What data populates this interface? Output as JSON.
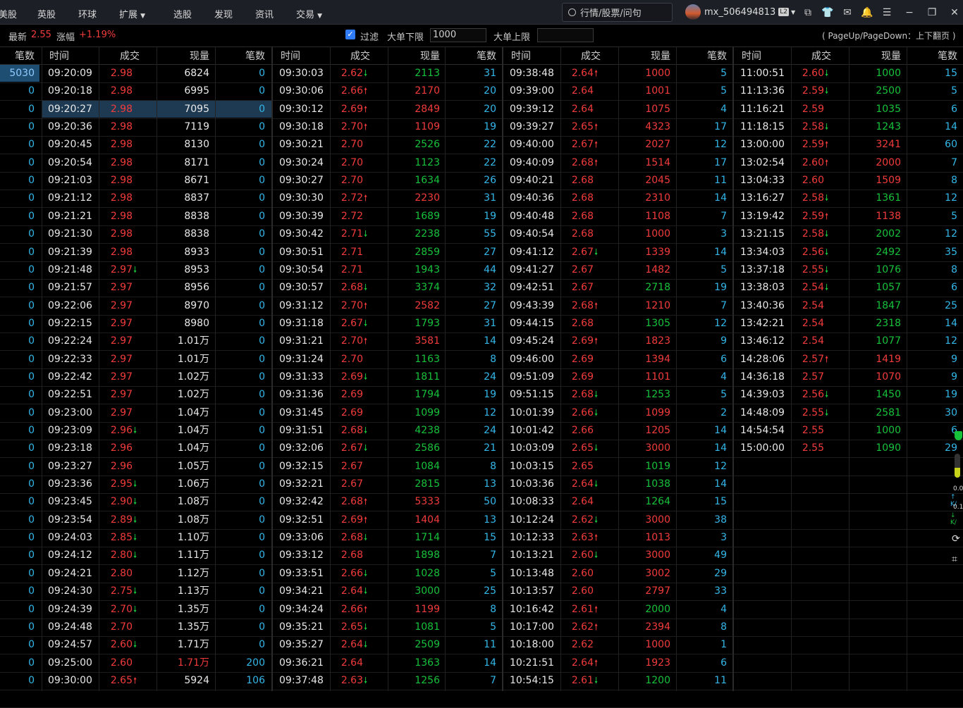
{
  "nav": [
    "美股",
    "英股",
    "环球",
    "扩展",
    "选股",
    "发现",
    "资讯",
    "交易"
  ],
  "search": {
    "placeholder": "行情/股票/问句"
  },
  "user": {
    "name": "mx_506494813",
    "level": "L2"
  },
  "info": {
    "latest_label": "最新",
    "latest_value": "2.55",
    "change_label": "涨幅",
    "change_value": "+1.19%",
    "filter_label": "过滤",
    "lower_label": "大单下限",
    "lower_value": "1000",
    "upper_label": "大单上限",
    "upper_value": "",
    "hint": "( PageUp/PageDown：上下翻页 )"
  },
  "headers": {
    "count": "笔数",
    "time": "时间",
    "price": "成交",
    "vol": "现量"
  },
  "first_count": {
    "value": "5030",
    "selected_row": 2
  },
  "col1": [
    [
      "0",
      "09:20:09",
      "2.98",
      "",
      "6824",
      "0"
    ],
    [
      "0",
      "09:20:18",
      "2.98",
      "",
      "6995",
      "0"
    ],
    [
      "0",
      "09:20:27",
      "2.98",
      "",
      "7095",
      "0"
    ],
    [
      "0",
      "09:20:36",
      "2.98",
      "",
      "7119",
      "0"
    ],
    [
      "0",
      "09:20:45",
      "2.98",
      "",
      "8130",
      "0"
    ],
    [
      "0",
      "09:20:54",
      "2.98",
      "",
      "8171",
      "0"
    ],
    [
      "0",
      "09:21:03",
      "2.98",
      "",
      "8671",
      "0"
    ],
    [
      "0",
      "09:21:12",
      "2.98",
      "",
      "8837",
      "0"
    ],
    [
      "0",
      "09:21:21",
      "2.98",
      "",
      "8838",
      "0"
    ],
    [
      "0",
      "09:21:30",
      "2.98",
      "",
      "8838",
      "0"
    ],
    [
      "0",
      "09:21:39",
      "2.98",
      "",
      "8933",
      "0"
    ],
    [
      "0",
      "09:21:48",
      "2.97",
      "down",
      "8953",
      "0"
    ],
    [
      "0",
      "09:21:57",
      "2.97",
      "",
      "8956",
      "0"
    ],
    [
      "0",
      "09:22:06",
      "2.97",
      "",
      "8970",
      "0"
    ],
    [
      "0",
      "09:22:15",
      "2.97",
      "",
      "8980",
      "0"
    ],
    [
      "0",
      "09:22:24",
      "2.97",
      "",
      "1.01万",
      "0"
    ],
    [
      "0",
      "09:22:33",
      "2.97",
      "",
      "1.01万",
      "0"
    ],
    [
      "0",
      "09:22:42",
      "2.97",
      "",
      "1.02万",
      "0"
    ],
    [
      "0",
      "09:22:51",
      "2.97",
      "",
      "1.02万",
      "0"
    ],
    [
      "0",
      "09:23:00",
      "2.97",
      "",
      "1.04万",
      "0"
    ],
    [
      "0",
      "09:23:09",
      "2.96",
      "down",
      "1.04万",
      "0"
    ],
    [
      "0",
      "09:23:18",
      "2.96",
      "",
      "1.04万",
      "0"
    ],
    [
      "0",
      "09:23:27",
      "2.96",
      "",
      "1.05万",
      "0"
    ],
    [
      "0",
      "09:23:36",
      "2.95",
      "down",
      "1.06万",
      "0"
    ],
    [
      "0",
      "09:23:45",
      "2.90",
      "down",
      "1.08万",
      "0"
    ],
    [
      "0",
      "09:23:54",
      "2.89",
      "down",
      "1.08万",
      "0"
    ],
    [
      "0",
      "09:24:03",
      "2.85",
      "down",
      "1.10万",
      "0"
    ],
    [
      "0",
      "09:24:12",
      "2.80",
      "down",
      "1.11万",
      "0"
    ],
    [
      "0",
      "09:24:21",
      "2.80",
      "",
      "1.12万",
      "0"
    ],
    [
      "0",
      "09:24:30",
      "2.75",
      "down",
      "1.13万",
      "0"
    ],
    [
      "0",
      "09:24:39",
      "2.70",
      "down",
      "1.35万",
      "0"
    ],
    [
      "0",
      "09:24:48",
      "2.70",
      "",
      "1.35万",
      "0"
    ],
    [
      "0",
      "09:24:57",
      "2.60",
      "down",
      "1.71万",
      "0"
    ],
    [
      "0",
      "09:25:00",
      "2.60",
      "",
      "1.71万",
      "200"
    ],
    [
      "0",
      "09:30:00",
      "2.65",
      "up",
      "5924",
      "106"
    ]
  ],
  "col2": [
    [
      "09:30:03",
      "2.62",
      "down",
      "2113",
      "31"
    ],
    [
      "09:30:06",
      "2.66",
      "up",
      "2170",
      "20"
    ],
    [
      "09:30:12",
      "2.69",
      "up",
      "2849",
      "20"
    ],
    [
      "09:30:18",
      "2.70",
      "up",
      "1109",
      "19"
    ],
    [
      "09:30:21",
      "2.70",
      "",
      "2526",
      "22"
    ],
    [
      "09:30:24",
      "2.70",
      "",
      "1123",
      "22"
    ],
    [
      "09:30:27",
      "2.70",
      "",
      "1634",
      "26"
    ],
    [
      "09:30:30",
      "2.72",
      "up",
      "2230",
      "31"
    ],
    [
      "09:30:39",
      "2.72",
      "",
      "1689",
      "19"
    ],
    [
      "09:30:42",
      "2.71",
      "down",
      "2238",
      "55"
    ],
    [
      "09:30:51",
      "2.71",
      "",
      "2859",
      "27"
    ],
    [
      "09:30:54",
      "2.71",
      "",
      "1943",
      "44"
    ],
    [
      "09:30:57",
      "2.68",
      "down",
      "3374",
      "32"
    ],
    [
      "09:31:12",
      "2.70",
      "up",
      "2582",
      "27"
    ],
    [
      "09:31:18",
      "2.67",
      "down",
      "1793",
      "31"
    ],
    [
      "09:31:21",
      "2.70",
      "up",
      "3581",
      "14"
    ],
    [
      "09:31:24",
      "2.70",
      "",
      "1163",
      "8"
    ],
    [
      "09:31:33",
      "2.69",
      "down",
      "1811",
      "24"
    ],
    [
      "09:31:36",
      "2.69",
      "",
      "1794",
      "19"
    ],
    [
      "09:31:45",
      "2.69",
      "",
      "1099",
      "12"
    ],
    [
      "09:31:51",
      "2.68",
      "down",
      "4238",
      "24"
    ],
    [
      "09:32:06",
      "2.67",
      "down",
      "2586",
      "21"
    ],
    [
      "09:32:15",
      "2.67",
      "",
      "1084",
      "8"
    ],
    [
      "09:32:21",
      "2.67",
      "",
      "2815",
      "13"
    ],
    [
      "09:32:42",
      "2.68",
      "up",
      "5333",
      "50"
    ],
    [
      "09:32:51",
      "2.69",
      "up",
      "1404",
      "13"
    ],
    [
      "09:33:06",
      "2.68",
      "down",
      "1714",
      "15"
    ],
    [
      "09:33:12",
      "2.68",
      "",
      "1898",
      "7"
    ],
    [
      "09:33:51",
      "2.66",
      "down",
      "1028",
      "5"
    ],
    [
      "09:34:21",
      "2.64",
      "down",
      "3000",
      "25"
    ],
    [
      "09:34:24",
      "2.66",
      "up",
      "1199",
      "8"
    ],
    [
      "09:35:21",
      "2.65",
      "down",
      "1081",
      "5"
    ],
    [
      "09:35:27",
      "2.64",
      "down",
      "2509",
      "11"
    ],
    [
      "09:36:21",
      "2.64",
      "",
      "1363",
      "14"
    ],
    [
      "09:37:48",
      "2.63",
      "down",
      "1256",
      "7"
    ]
  ],
  "col3": [
    [
      "09:38:48",
      "2.64",
      "up",
      "1000",
      "5"
    ],
    [
      "09:39:00",
      "2.64",
      "",
      "1001",
      "5"
    ],
    [
      "09:39:12",
      "2.64",
      "",
      "1075",
      "4"
    ],
    [
      "09:39:27",
      "2.65",
      "up",
      "4323",
      "17"
    ],
    [
      "09:40:00",
      "2.67",
      "up",
      "2027",
      "12"
    ],
    [
      "09:40:09",
      "2.68",
      "up",
      "1514",
      "17"
    ],
    [
      "09:40:21",
      "2.68",
      "",
      "2045",
      "11"
    ],
    [
      "09:40:36",
      "2.68",
      "",
      "2310",
      "14"
    ],
    [
      "09:40:48",
      "2.68",
      "",
      "1108",
      "7"
    ],
    [
      "09:40:54",
      "2.68",
      "",
      "1000",
      "3"
    ],
    [
      "09:41:12",
      "2.67",
      "down",
      "1339",
      "14"
    ],
    [
      "09:41:27",
      "2.67",
      "",
      "1482",
      "5"
    ],
    [
      "09:42:51",
      "2.67",
      "",
      "2718",
      "19"
    ],
    [
      "09:43:39",
      "2.68",
      "up",
      "1210",
      "7"
    ],
    [
      "09:44:15",
      "2.68",
      "",
      "1305",
      "12"
    ],
    [
      "09:45:24",
      "2.69",
      "up",
      "1823",
      "9"
    ],
    [
      "09:46:00",
      "2.69",
      "",
      "1394",
      "6"
    ],
    [
      "09:51:09",
      "2.69",
      "",
      "1101",
      "4"
    ],
    [
      "09:51:15",
      "2.68",
      "down",
      "1253",
      "5"
    ],
    [
      "10:01:39",
      "2.66",
      "down",
      "1099",
      "2"
    ],
    [
      "10:01:42",
      "2.66",
      "",
      "1205",
      "14"
    ],
    [
      "10:03:09",
      "2.65",
      "down",
      "3000",
      "14"
    ],
    [
      "10:03:15",
      "2.65",
      "",
      "1019",
      "12"
    ],
    [
      "10:03:36",
      "2.64",
      "down",
      "1038",
      "14"
    ],
    [
      "10:08:33",
      "2.64",
      "",
      "1264",
      "15"
    ],
    [
      "10:12:24",
      "2.62",
      "down",
      "3000",
      "38"
    ],
    [
      "10:12:33",
      "2.63",
      "up",
      "1013",
      "3"
    ],
    [
      "10:13:21",
      "2.60",
      "down",
      "3000",
      "49"
    ],
    [
      "10:13:48",
      "2.60",
      "",
      "3002",
      "29"
    ],
    [
      "10:13:57",
      "2.60",
      "",
      "2797",
      "33"
    ],
    [
      "10:16:42",
      "2.61",
      "up",
      "2000",
      "4"
    ],
    [
      "10:17:00",
      "2.62",
      "up",
      "2394",
      "8"
    ],
    [
      "10:18:00",
      "2.62",
      "",
      "1000",
      "1"
    ],
    [
      "10:21:51",
      "2.64",
      "up",
      "1923",
      "6"
    ],
    [
      "10:54:15",
      "2.61",
      "down",
      "1200",
      "11"
    ]
  ],
  "col4": [
    [
      "11:00:51",
      "2.60",
      "down",
      "1000",
      "15"
    ],
    [
      "11:13:36",
      "2.59",
      "down",
      "2500",
      "5"
    ],
    [
      "11:16:21",
      "2.59",
      "",
      "1035",
      "6"
    ],
    [
      "11:18:15",
      "2.58",
      "down",
      "1243",
      "14"
    ],
    [
      "13:00:00",
      "2.59",
      "up",
      "3241",
      "60"
    ],
    [
      "13:02:54",
      "2.60",
      "up",
      "2000",
      "7"
    ],
    [
      "13:04:33",
      "2.60",
      "",
      "1509",
      "8"
    ],
    [
      "13:16:27",
      "2.58",
      "down",
      "1361",
      "12"
    ],
    [
      "13:19:42",
      "2.59",
      "up",
      "1138",
      "5"
    ],
    [
      "13:21:15",
      "2.58",
      "down",
      "2002",
      "12"
    ],
    [
      "13:34:03",
      "2.56",
      "down",
      "2492",
      "35"
    ],
    [
      "13:37:18",
      "2.55",
      "down",
      "1076",
      "8"
    ],
    [
      "13:38:03",
      "2.54",
      "down",
      "1057",
      "6"
    ],
    [
      "13:40:36",
      "2.54",
      "",
      "1847",
      "25"
    ],
    [
      "13:42:21",
      "2.54",
      "",
      "2318",
      "14"
    ],
    [
      "13:46:12",
      "2.54",
      "",
      "1077",
      "12"
    ],
    [
      "14:28:06",
      "2.57",
      "up",
      "1419",
      "9"
    ],
    [
      "14:36:18",
      "2.57",
      "",
      "1070",
      "9"
    ],
    [
      "14:39:03",
      "2.56",
      "down",
      "1450",
      "19"
    ],
    [
      "14:48:09",
      "2.55",
      "down",
      "2581",
      "30"
    ],
    [
      "14:54:54",
      "2.55",
      "",
      "1000",
      "6"
    ],
    [
      "15:00:00",
      "2.55",
      "",
      "1090",
      "29"
    ]
  ],
  "side_widget": {
    "v1": "0.0",
    "v2": "K/",
    "v3": "0.1",
    "v4": "K/"
  }
}
